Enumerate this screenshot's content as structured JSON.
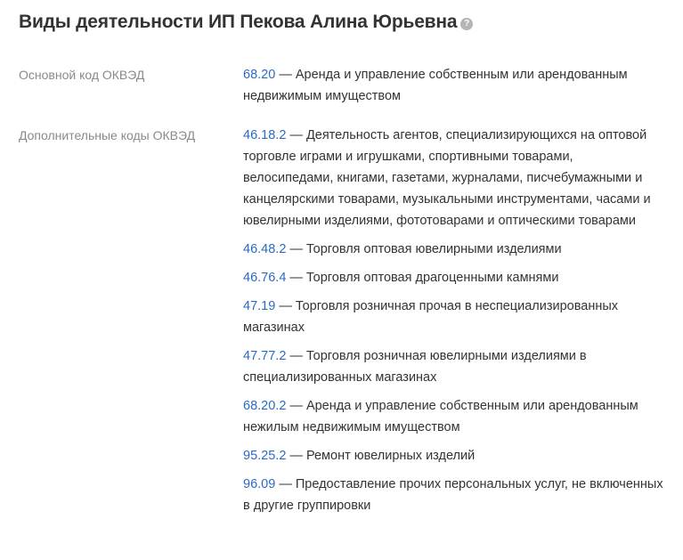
{
  "header": {
    "title": "Виды деятельности ИП Пекова Алина Юрьевна",
    "help_icon": "question-circle-icon"
  },
  "main_okved": {
    "label": "Основной код ОКВЭД",
    "code": "68.20",
    "description": " — Аренда и управление собственным или арендованным недвижимым имуществом"
  },
  "extra_okved": {
    "label": "Дополнительные коды ОКВЭД",
    "items": [
      {
        "code": "46.18.2",
        "description": " — Деятельность агентов, специализирующихся на оптовой торговле играми и игрушками, спортивными товарами, велосипедами, книгами, газетами, журналами, писчебумажными и канцелярскими товарами, музыкальными инструментами, часами и ювелирными изделиями, фототоварами и оптическими товарами"
      },
      {
        "code": "46.48.2",
        "description": " — Торговля оптовая ювелирными изделиями"
      },
      {
        "code": "46.76.4",
        "description": " — Торговля оптовая драгоценными камнями"
      },
      {
        "code": "47.19",
        "description": " — Торговля розничная прочая в неспециализированных магазинах"
      },
      {
        "code": "47.77.2",
        "description": " — Торговля розничная ювелирными изделиями в специализированных магазинах"
      },
      {
        "code": "68.20.2",
        "description": " — Аренда и управление собственным или арендованным нежилым недвижимым имуществом"
      },
      {
        "code": "95.25.2",
        "description": " — Ремонт ювелирных изделий"
      },
      {
        "code": "96.09",
        "description": " — Предоставление прочих персональных услуг, не включенных в другие группировки"
      }
    ]
  },
  "colors": {
    "link": "#2a6bbf",
    "label": "#8a8a8a",
    "text": "#333333"
  }
}
